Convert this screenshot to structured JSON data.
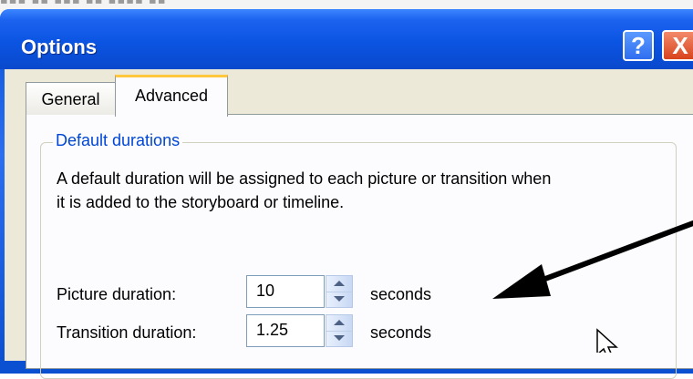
{
  "window": {
    "title": "Options",
    "help_button": "?",
    "close_button": "X"
  },
  "tabs": [
    {
      "label": "General",
      "active": false
    },
    {
      "label": "Advanced",
      "active": true
    }
  ],
  "group": {
    "label": "Default durations",
    "description_line1": "A default duration will be assigned to each picture or transition when",
    "description_line2": "it is added to the storyboard or timeline."
  },
  "fields": {
    "picture": {
      "label": "Picture duration:",
      "value": "10",
      "unit": "seconds"
    },
    "transition": {
      "label": "Transition duration:",
      "value": "1.25",
      "unit": "seconds"
    }
  },
  "colors": {
    "titlebar": "#0b54e2",
    "tab_highlight": "#ffc83c",
    "group_label": "#0046d5",
    "annotation_arrow": "#000000"
  },
  "icons": {
    "help": "help-icon",
    "close": "close-icon",
    "spin_up": "chevron-up-icon",
    "spin_down": "chevron-down-icon",
    "cursor": "mouse-cursor-icon",
    "annotation": "annotation-arrow-icon"
  }
}
